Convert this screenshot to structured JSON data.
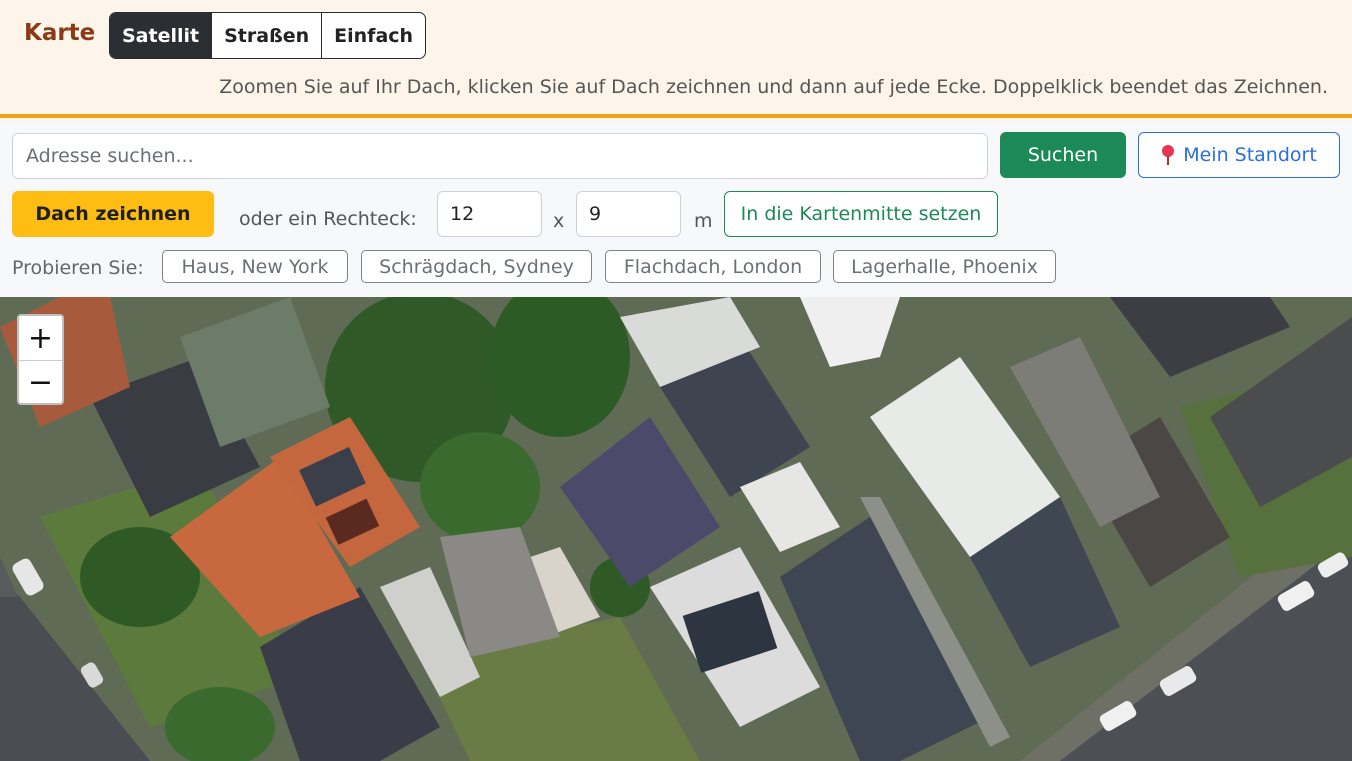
{
  "header": {
    "title": "Karte",
    "map_modes": [
      "Satellit",
      "Straßen",
      "Einfach"
    ],
    "active_mode": "Satellit",
    "hint": "Zoomen Sie auf Ihr Dach, klicken Sie auf Dach zeichnen und dann auf jede Ecke. Doppelklick beendet das Zeichnen."
  },
  "search": {
    "placeholder": "Adresse suchen...",
    "value": "",
    "search_label": "Suchen",
    "location_label": "Mein Standort"
  },
  "draw": {
    "draw_label": "Dach zeichnen",
    "rect_label": "oder ein Rechteck:",
    "width_value": "12",
    "x_label": "x",
    "height_value": "9",
    "unit_label": "m",
    "center_label": "In die Kartenmitte setzen"
  },
  "examples": {
    "label": "Probieren Sie:",
    "items": [
      "Haus, New York",
      "Schrägdach, Sydney",
      "Flachdach, London",
      "Lagerhalle, Phoenix"
    ]
  },
  "map": {
    "zoom_in": "+",
    "zoom_out": "−"
  },
  "colors": {
    "accent": "#f0a21c",
    "primary_green": "#1b8a57",
    "draw_yellow": "#fdbd12",
    "link_blue": "#2a6fdb",
    "title_brown": "#8a3a14"
  }
}
